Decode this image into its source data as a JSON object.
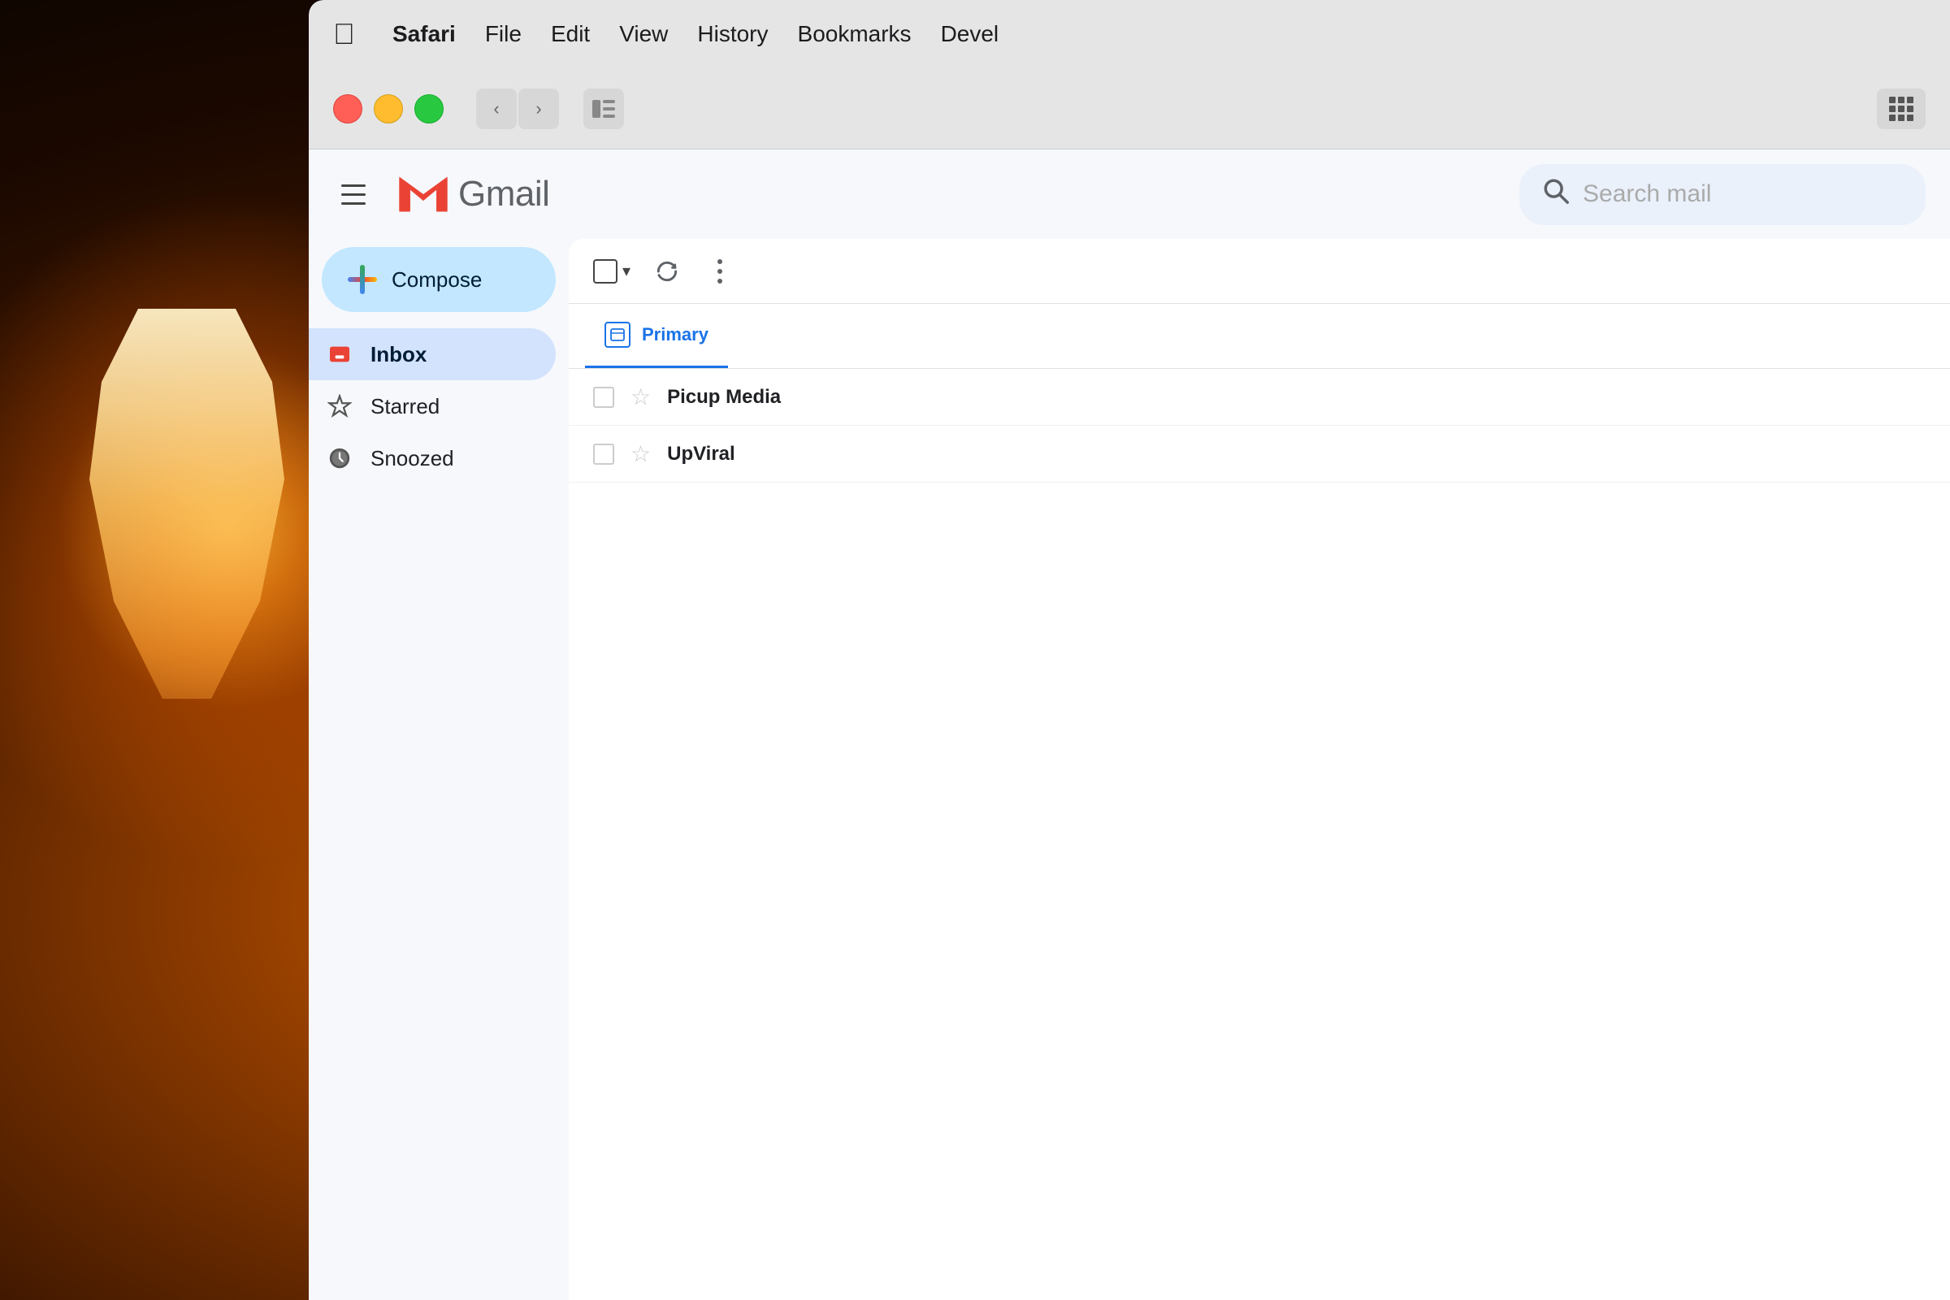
{
  "background": {
    "color": "#1a0800"
  },
  "menubar": {
    "apple_label": "",
    "items": [
      {
        "label": "Safari",
        "bold": true
      },
      {
        "label": "File",
        "bold": false
      },
      {
        "label": "Edit",
        "bold": false
      },
      {
        "label": "View",
        "bold": false
      },
      {
        "label": "History",
        "bold": false
      },
      {
        "label": "Bookmarks",
        "bold": false
      },
      {
        "label": "Devel",
        "bold": false
      }
    ]
  },
  "safari": {
    "back_btn": "‹",
    "forward_btn": "›"
  },
  "gmail": {
    "logo_text": "Gmail",
    "search_placeholder": "Search mail",
    "compose_label": "Compose",
    "nav_items": [
      {
        "label": "Inbox",
        "active": true
      },
      {
        "label": "Starred",
        "active": false
      },
      {
        "label": "Snoozed",
        "active": false
      }
    ],
    "toolbar": {
      "refresh_label": "↻",
      "more_label": "⋮"
    },
    "tabs": [
      {
        "label": "Primary",
        "active": true
      }
    ],
    "emails": [
      {
        "sender": "Picup Media",
        "star": false
      },
      {
        "sender": "UpViral",
        "star": false
      }
    ]
  },
  "colors": {
    "gmail_red": "#EA4335",
    "gmail_blue": "#4285F4",
    "gmail_green": "#34A853",
    "gmail_yellow": "#FBBC04",
    "tab_active": "#1a73e8",
    "inbox_bg": "#d3e3fd",
    "compose_bg": "#c2e7ff"
  }
}
